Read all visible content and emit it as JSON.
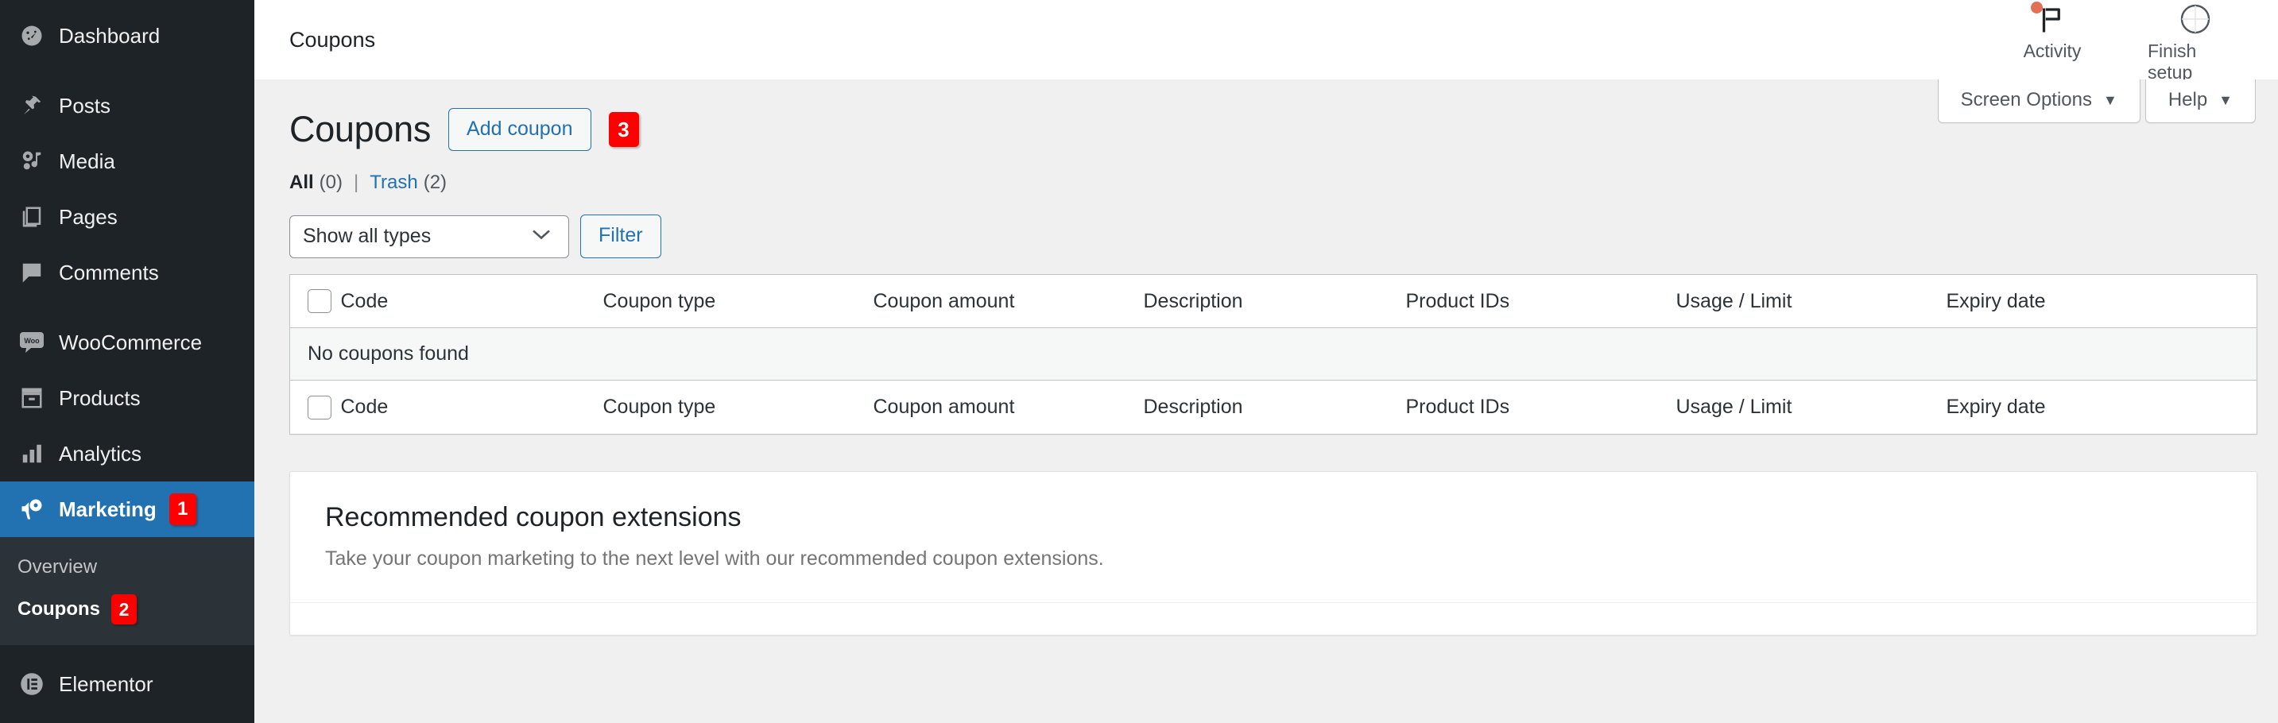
{
  "sidebar": {
    "items": [
      {
        "label": "Dashboard",
        "icon": "dashboard-icon",
        "current": false
      },
      {
        "label": "Posts",
        "icon": "pin-icon",
        "current": false
      },
      {
        "label": "Media",
        "icon": "media-icon",
        "current": false
      },
      {
        "label": "Pages",
        "icon": "pages-icon",
        "current": false
      },
      {
        "label": "Comments",
        "icon": "comments-icon",
        "current": false
      },
      {
        "label": "WooCommerce",
        "icon": "woocommerce-icon",
        "current": false
      },
      {
        "label": "Products",
        "icon": "products-icon",
        "current": false
      },
      {
        "label": "Analytics",
        "icon": "analytics-icon",
        "current": false
      },
      {
        "label": "Marketing",
        "icon": "megaphone-icon",
        "current": true,
        "badge": "1"
      },
      {
        "label": "Elementor",
        "icon": "elementor-icon",
        "current": false
      }
    ],
    "submenu": [
      {
        "label": "Overview",
        "current": false
      },
      {
        "label": "Coupons",
        "current": true,
        "badge": "2"
      }
    ]
  },
  "topbar": {
    "title": "Coupons",
    "activity_label": "Activity",
    "activity_icon": "flag-icon",
    "finish_setup_label": "Finish setup",
    "finish_setup_icon": "progress-circle-icon"
  },
  "screen_options": {
    "screen_options_label": "Screen Options",
    "help_label": "Help",
    "caret": "▼"
  },
  "page": {
    "title": "Coupons",
    "add_button": "Add coupon",
    "add_badge": "3"
  },
  "views": {
    "all_label": "All",
    "all_count": "(0)",
    "divider": "|",
    "trash_label": "Trash",
    "trash_count": "(2)"
  },
  "tablenav": {
    "type_filter_value": "Show all types",
    "type_filter_options": [
      "Show all types"
    ],
    "filter_button": "Filter"
  },
  "table": {
    "columns": [
      "Code",
      "Coupon type",
      "Coupon amount",
      "Description",
      "Product IDs",
      "Usage / Limit",
      "Expiry date"
    ],
    "empty_message": "No coupons found",
    "rows": []
  },
  "recommended": {
    "title": "Recommended coupon extensions",
    "subtitle": "Take your coupon marketing to the next level with our recommended coupon extensions."
  },
  "colors": {
    "sidebar_bg": "#1d2327",
    "submenu_bg": "#2c3338",
    "accent_blue": "#2271b1",
    "badge_red": "#ff0000",
    "content_bg": "#f0f0f1"
  }
}
